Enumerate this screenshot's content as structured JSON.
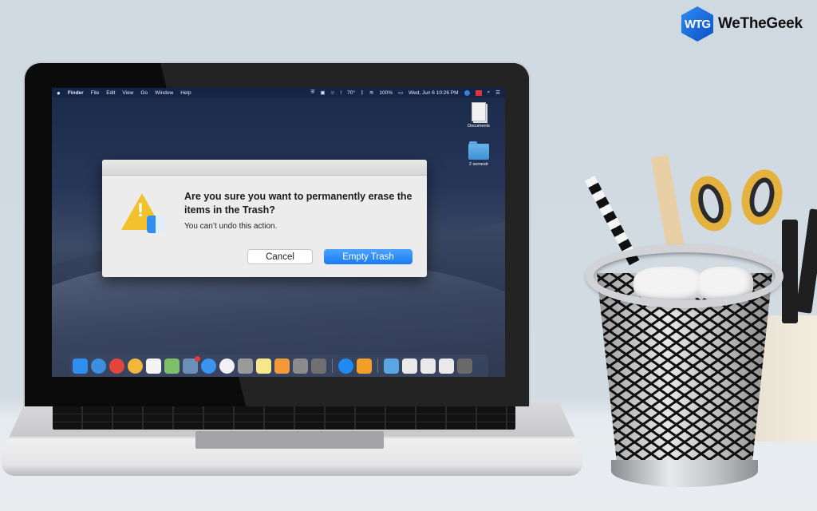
{
  "brand": {
    "logo_mark": "WTG",
    "name": "WeTheGeek"
  },
  "menubar": {
    "apple_icon": "apple-logo-icon",
    "app_name": "Finder",
    "menus": [
      "File",
      "Edit",
      "View",
      "Go",
      "Window",
      "Help"
    ],
    "status": {
      "temperature": "70°",
      "battery": "100%",
      "datetime": "Wed, Jun 6 10:26 PM"
    },
    "status_icons": [
      "shield-icon",
      "cast-icon",
      "monitor-icon",
      "alert-icon",
      "bluetooth-icon",
      "wifi-icon",
      "battery-icon",
      "globe-icon",
      "flag-icon",
      "search-icon",
      "list-icon"
    ]
  },
  "desktop": {
    "icons": [
      {
        "label": "Documents",
        "type": "document"
      },
      {
        "label": "2 semestr",
        "type": "folder"
      }
    ]
  },
  "dialog": {
    "title": "Are you sure you want to permanently erase the items in the Trash?",
    "message": "You can’t undo this action.",
    "icon": "warning-finder-icon",
    "cancel_label": "Cancel",
    "confirm_label": "Empty Trash",
    "confirm_color": "#1a7bf2"
  },
  "dock": {
    "apps": [
      {
        "name": "Finder",
        "color": "#2f8ff0",
        "running": true
      },
      {
        "name": "Safari",
        "color": "#3a8fe0",
        "running": true
      },
      {
        "name": "Chrome",
        "color": "#e4453a",
        "running": false
      },
      {
        "name": "Photos",
        "color": "#f4b63a",
        "running": false
      },
      {
        "name": "Calendar",
        "color": "#f4f4f4",
        "running": false
      },
      {
        "name": "Maps",
        "color": "#7fbf6a",
        "running": false
      },
      {
        "name": "Preview",
        "color": "#6b8fb8",
        "running": true,
        "badge": true
      },
      {
        "name": "Messages",
        "color": "#3b95ef",
        "running": true
      },
      {
        "name": "iTunes",
        "color": "#f0f0f5",
        "running": false
      },
      {
        "name": "Archive Utility",
        "color": "#9a9a9a",
        "running": false
      },
      {
        "name": "Notes",
        "color": "#f7e98a",
        "running": false
      },
      {
        "name": "Pages",
        "color": "#f29a3a",
        "running": true
      },
      {
        "name": "Image Capture",
        "color": "#8c8c8c",
        "running": false
      },
      {
        "name": "System Preferences",
        "color": "#707070",
        "running": false
      },
      {
        "name": "App Store",
        "color": "#1d8bf1",
        "running": false,
        "group_start": true
      },
      {
        "name": "Home",
        "color": "#f3a02b",
        "running": false
      },
      {
        "name": "Downloads Folder",
        "color": "#5aa6e2",
        "running": false,
        "group_start": true
      },
      {
        "name": "Document Stack 1",
        "color": "#e9e9e9",
        "running": false
      },
      {
        "name": "Document Stack 2",
        "color": "#e9e9e9",
        "running": false
      },
      {
        "name": "Document Stack 3",
        "color": "#e9e9e9",
        "running": false
      },
      {
        "name": "Trash",
        "color": "#6a6a6a",
        "running": false
      }
    ]
  }
}
